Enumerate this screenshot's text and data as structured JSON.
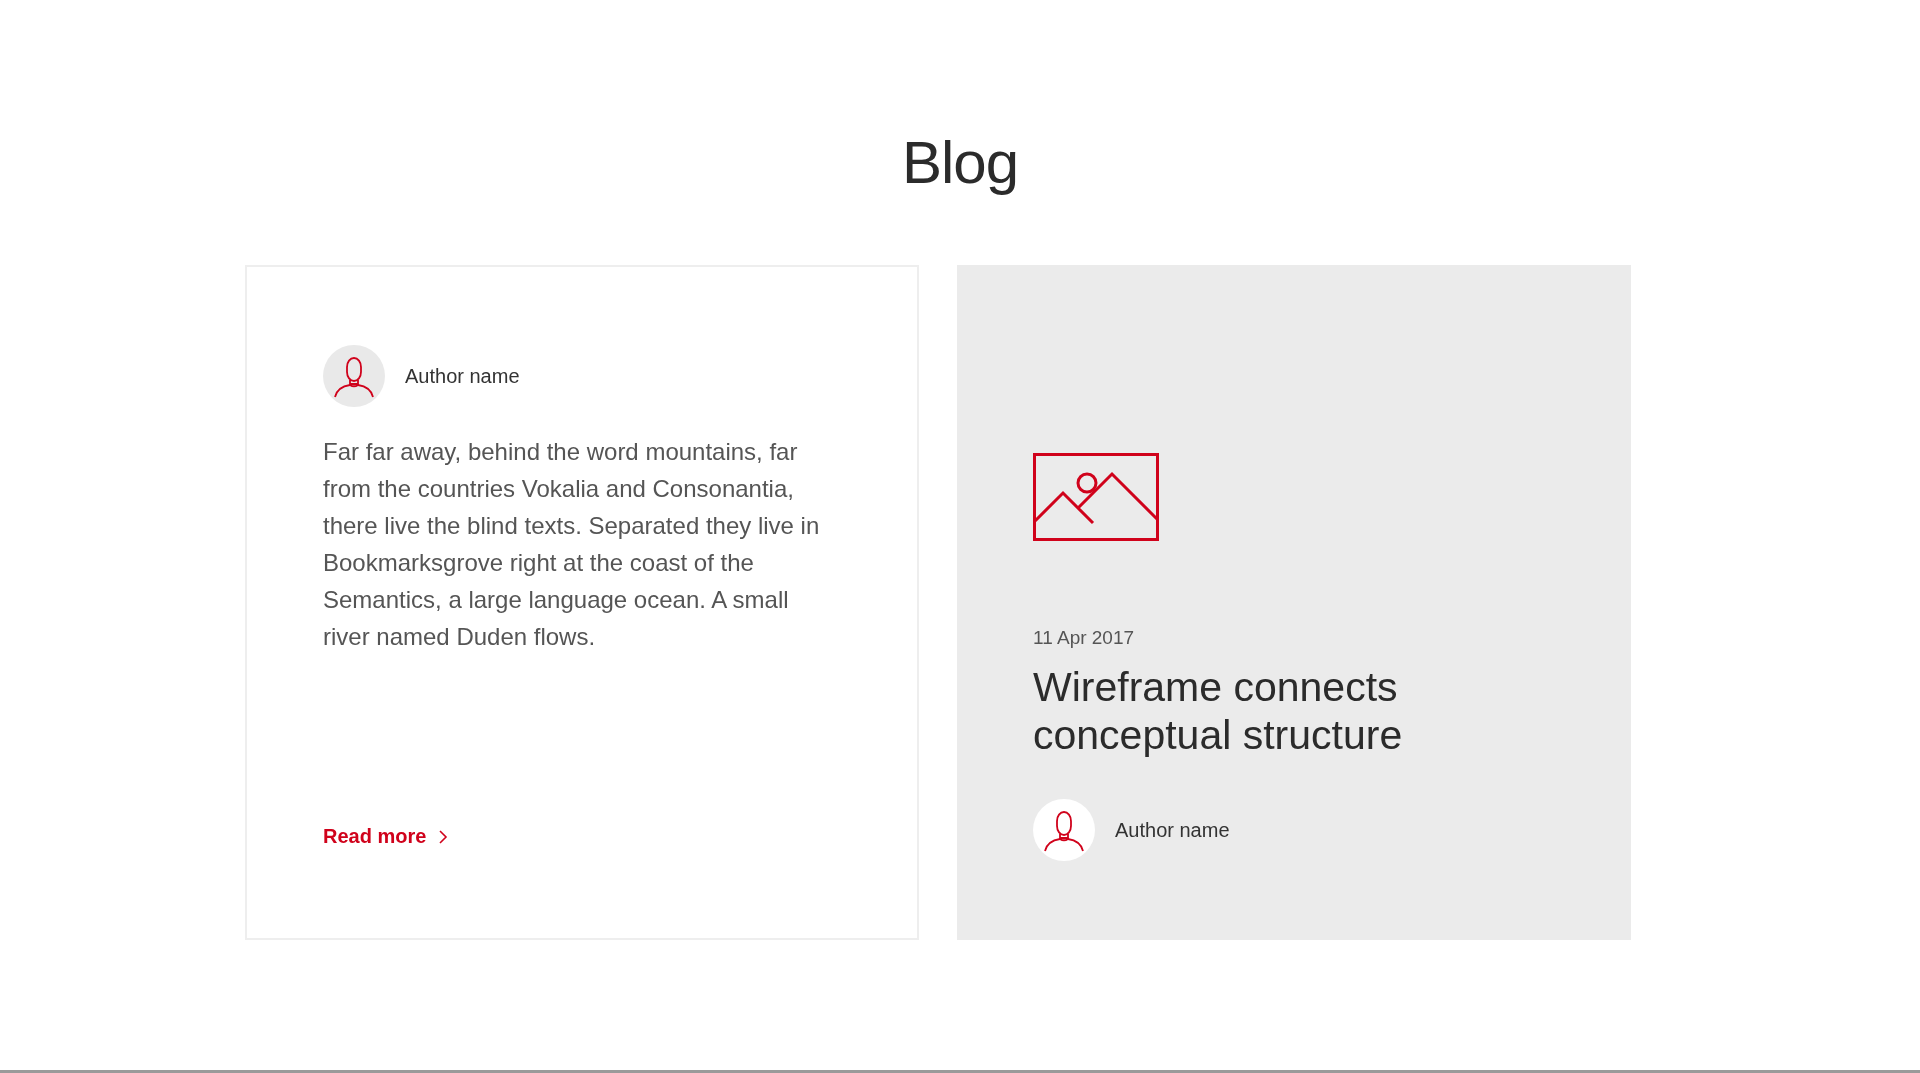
{
  "title": "Blog",
  "cards": [
    {
      "kind": "text",
      "author": "Author name",
      "body": "Far far away, behind the word mountains, far from the countries Vokalia and Consonantia, there live the blind texts. Separated they live in Bookmarksgrove right at the coast of the Semantics, a large language ocean. A small river named Duden flows.",
      "link": "Read more"
    },
    {
      "kind": "image",
      "date": "11 Apr 2017",
      "heading": "Wireframe connects conceptual structure",
      "author": "Author name"
    }
  ]
}
